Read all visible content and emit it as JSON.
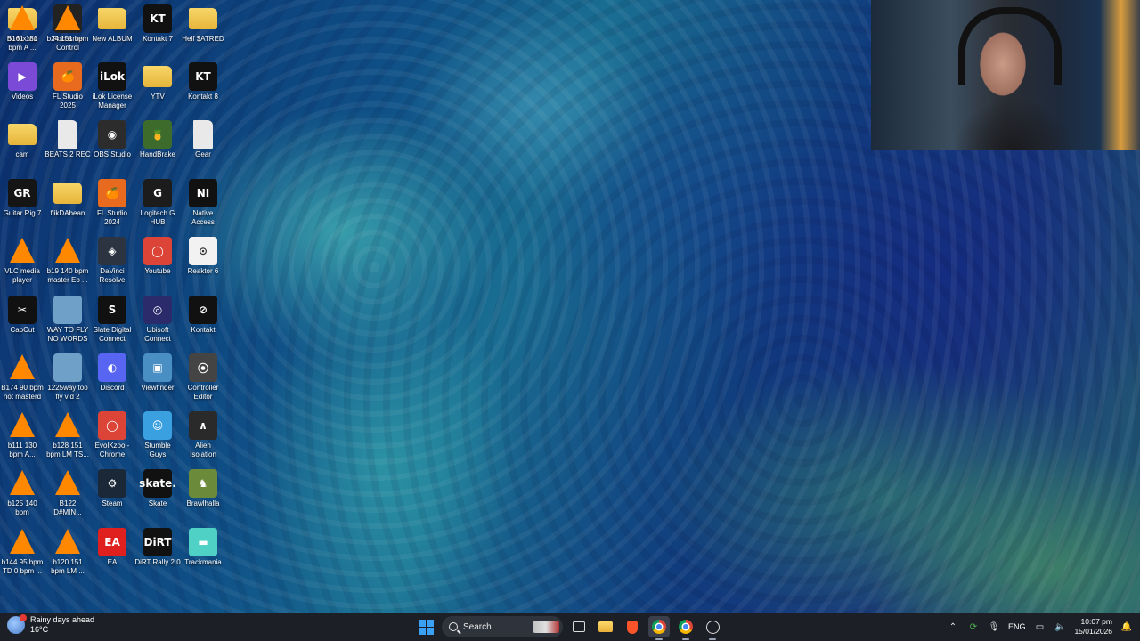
{
  "desktop": {
    "icons": [
      {
        "label": "no fux vid",
        "kind": "folder-video"
      },
      {
        "label": "Focusrite\nControl",
        "kind": "app"
      },
      {
        "label": "New ALBUM",
        "kind": "folder"
      },
      {
        "label": "Kontakt 7",
        "kind": "app"
      },
      {
        "label": "Helf $ATRED",
        "kind": "folder"
      },
      {
        "label": "Videos",
        "kind": "app"
      },
      {
        "label": "FL Studio\n2025",
        "kind": "app"
      },
      {
        "label": "iLok License\nManager",
        "kind": "app"
      },
      {
        "label": "YTV",
        "kind": "folder"
      },
      {
        "label": "Kontakt 8",
        "kind": "app"
      },
      {
        "label": "cam",
        "kind": "folder"
      },
      {
        "label": "BEATS 2 REC",
        "kind": "file"
      },
      {
        "label": "OBS Studio",
        "kind": "app"
      },
      {
        "label": "HandBrake",
        "kind": "app"
      },
      {
        "label": "Gear",
        "kind": "file"
      },
      {
        "label": "Guitar Rig 7",
        "kind": "app"
      },
      {
        "label": "flikDAbean",
        "kind": "folder"
      },
      {
        "label": "FL Studio\n2024",
        "kind": "app"
      },
      {
        "label": "Logitech G\nHUB",
        "kind": "app"
      },
      {
        "label": "Native\nAccess",
        "kind": "app"
      },
      {
        "label": "VLC media\nplayer",
        "kind": "vlc"
      },
      {
        "label": "b19 140 bpm\nmaster Eb ...",
        "kind": "vlc"
      },
      {
        "label": "DaVinci\nResolve",
        "kind": "app"
      },
      {
        "label": "Youtube",
        "kind": "app"
      },
      {
        "label": "Reaktor 6",
        "kind": "app"
      },
      {
        "label": "CapCut",
        "kind": "app"
      },
      {
        "label": "WAY TO FLY\nNO WORDS",
        "kind": "image"
      },
      {
        "label": "Slate Digital\nConnect",
        "kind": "app"
      },
      {
        "label": "Ubisoft\nConnect",
        "kind": "app"
      },
      {
        "label": "Kontakt",
        "kind": "app"
      },
      {
        "label": "B174 90 bpm\nnot masterd",
        "kind": "vlc"
      },
      {
        "label": "1225way too\nfly vid 2",
        "kind": "image"
      },
      {
        "label": "Discord",
        "kind": "app"
      },
      {
        "label": "Viewfinder",
        "kind": "app"
      },
      {
        "label": "Controller\nEditor",
        "kind": "app"
      },
      {
        "label": "b111 130\nbpm A...",
        "kind": "vlc"
      },
      {
        "label": "b128 151\nbpm LM TS...",
        "kind": "vlc"
      },
      {
        "label": "EvolKzoo -\nChrome",
        "kind": "app"
      },
      {
        "label": "Stumble\nGuys",
        "kind": "app"
      },
      {
        "label": "Alien\nIsolation",
        "kind": "app"
      },
      {
        "label": "b125 140\nbpm",
        "kind": "vlc"
      },
      {
        "label": "B122\nD#MIN...",
        "kind": "vlc"
      },
      {
        "label": "Steam",
        "kind": "app"
      },
      {
        "label": "Skate",
        "kind": "app"
      },
      {
        "label": "Brawlhalla",
        "kind": "app"
      },
      {
        "label": "b144 95 bpm\nTD 0 bpm ...",
        "kind": "vlc"
      },
      {
        "label": "b120 151\nbpm LM ...",
        "kind": "vlc"
      },
      {
        "label": "EA",
        "kind": "app"
      },
      {
        "label": "DiRT Rally 2.0",
        "kind": "app"
      },
      {
        "label": "Trackmania",
        "kind": "app"
      },
      {
        "label": "B161 151\nbpm A ...",
        "kind": "vlc"
      },
      {
        "label": "b24 151 bpm",
        "kind": "vlc"
      }
    ],
    "glyphs": [
      "",
      "▮▮",
      "",
      "KT",
      "",
      "▶",
      "🍊",
      "iLok",
      "",
      "KT",
      "",
      "",
      "◉",
      "🍍",
      "",
      "GR",
      "",
      "🍊",
      "G",
      "NI",
      "",
      "",
      "◈",
      "◯",
      "⊙",
      "✂",
      "",
      "S",
      "◎",
      "⊘",
      "",
      "",
      "◐",
      "▣",
      "⦿",
      "",
      "",
      "◯",
      "☺",
      "∧",
      "",
      "",
      "⚙",
      "skate.",
      "♞",
      "",
      "",
      "EA",
      "DiRT",
      "▬",
      "",
      ""
    ],
    "colors": [
      "#f4c542",
      "#222222",
      "#f4c542",
      "#111111",
      "#f4c542",
      "#7b4bd8",
      "#e86a1e",
      "#111111",
      "#f4c542",
      "#111111",
      "#f4c542",
      "#e9e9e9",
      "#2c2c2c",
      "#3d6b2c",
      "#e9e9e9",
      "#151515",
      "#f4c542",
      "#e86a1e",
      "#1c1c1c",
      "#111111",
      "#ff8800",
      "#ff8800",
      "#2b3440",
      "#db4437",
      "#f2f2f2",
      "#111111",
      "#6fa0c8",
      "#111111",
      "#2b2b6b",
      "#111111",
      "#ff8800",
      "#6fa0c8",
      "#5865f2",
      "#4a8fc4",
      "#444444",
      "#ff8800",
      "#ff8800",
      "#db4437",
      "#3aa0e0",
      "#2a2a2a",
      "#ff8800",
      "#ff8800",
      "#1b2838",
      "#111111",
      "#6b8a3a",
      "#ff8800",
      "#ff8800",
      "#e0201e",
      "#111111",
      "#4fd1c5",
      "#ff8800",
      "#ff8800"
    ]
  },
  "weather": {
    "title": "Rainy days ahead",
    "temp": "16°C"
  },
  "taskbar": {
    "search_label": "Search",
    "pinned": [
      "task-view",
      "file-explorer",
      "brave",
      "chrome-profile",
      "chrome",
      "github"
    ]
  },
  "tray": {
    "language": "ENG",
    "time": "10:07 pm",
    "date": "15/01/2026"
  }
}
